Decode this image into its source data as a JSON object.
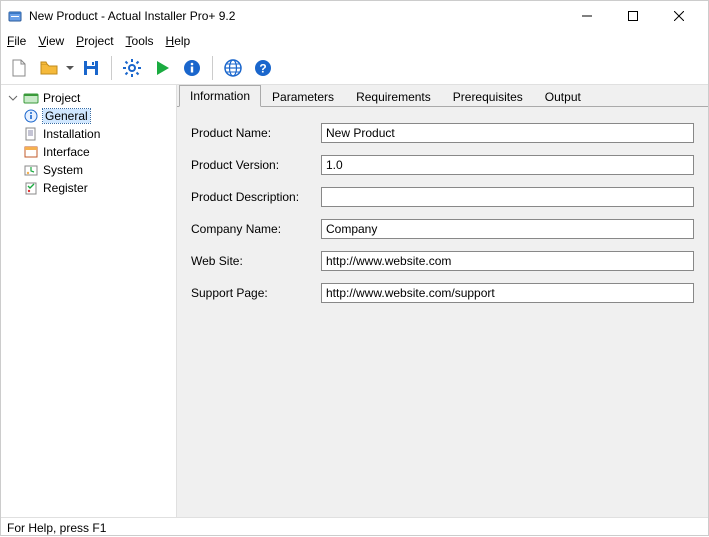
{
  "window": {
    "title": "New Product - Actual Installer Pro+ 9.2"
  },
  "menu": {
    "file": "File",
    "view": "View",
    "project": "Project",
    "tools": "Tools",
    "help": "Help"
  },
  "tree": {
    "root": "Project",
    "items": [
      {
        "label": "General"
      },
      {
        "label": "Installation"
      },
      {
        "label": "Interface"
      },
      {
        "label": "System"
      },
      {
        "label": "Register"
      }
    ]
  },
  "tabs": {
    "information": "Information",
    "parameters": "Parameters",
    "requirements": "Requirements",
    "prerequisites": "Prerequisites",
    "output": "Output"
  },
  "form": {
    "product_name": {
      "label": "Product Name:",
      "value": "New Product"
    },
    "product_version": {
      "label": "Product Version:",
      "value": "1.0"
    },
    "product_description": {
      "label": "Product Description:",
      "value": ""
    },
    "company_name": {
      "label": "Company Name:",
      "value": "Company"
    },
    "web_site": {
      "label": "Web Site:",
      "value": "http://www.website.com"
    },
    "support_page": {
      "label": "Support Page:",
      "value": "http://www.website.com/support"
    }
  },
  "statusbar": {
    "text": "For Help, press F1"
  }
}
